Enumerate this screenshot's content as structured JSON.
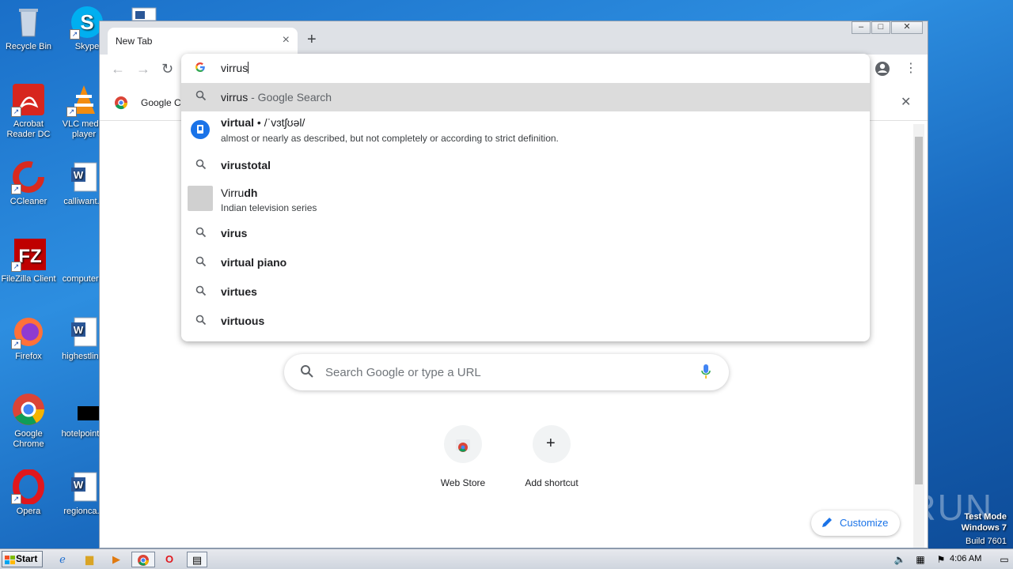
{
  "desktop": {
    "icons": [
      {
        "label": "Recycle Bin"
      },
      {
        "label": "Skype"
      },
      {
        "label": "Acrobat Reader DC"
      },
      {
        "label": "VLC media player"
      },
      {
        "label": "CCleaner"
      },
      {
        "label": "calliwant..."
      },
      {
        "label": "FileZilla Client"
      },
      {
        "label": "computer..."
      },
      {
        "label": "Firefox"
      },
      {
        "label": "highestlin..."
      },
      {
        "label": "Google Chrome"
      },
      {
        "label": "hotelpoint..."
      },
      {
        "label": "Opera"
      },
      {
        "label": "regionca..."
      }
    ],
    "watermark": {
      "line1": "Test Mode",
      "line2": "Windows 7",
      "line3": "Build 7601",
      "logo": "ANY.RUN"
    }
  },
  "browser": {
    "tab_title": "New Tab",
    "tab_close_glyph": "×",
    "newtab_glyph": "+",
    "bookmark_label": "Google Cl",
    "omnibox": {
      "input_value": "virrus",
      "suggestions": [
        {
          "type": "search",
          "bold": "virrus",
          "rest": " - Google Search",
          "highlighted": true
        },
        {
          "type": "dictionary",
          "bold": "virtual",
          "rest": " • /ˈvɜtʃʊəl/",
          "desc": "almost or nearly as described, but not completely or according to strict definition."
        },
        {
          "type": "search",
          "bold": "virustotal"
        },
        {
          "type": "entity",
          "plain": "Virru",
          "bold": "dh",
          "desc": "Indian television series"
        },
        {
          "type": "search",
          "bold": "virus"
        },
        {
          "type": "search",
          "bold": "virtual piano"
        },
        {
          "type": "search",
          "bold": "virtues"
        },
        {
          "type": "search",
          "bold": "virtuous"
        }
      ]
    },
    "ntp": {
      "search_placeholder": "Search Google or type a URL",
      "shortcuts": [
        {
          "label": "Web Store"
        },
        {
          "label": "Add shortcut"
        }
      ],
      "customize_label": "Customize"
    }
  },
  "taskbar": {
    "start_label": "Start",
    "clock": "4:06 AM"
  },
  "colors": {
    "accent": "#1a73e8",
    "highlight_row": "#dcdcdc"
  }
}
